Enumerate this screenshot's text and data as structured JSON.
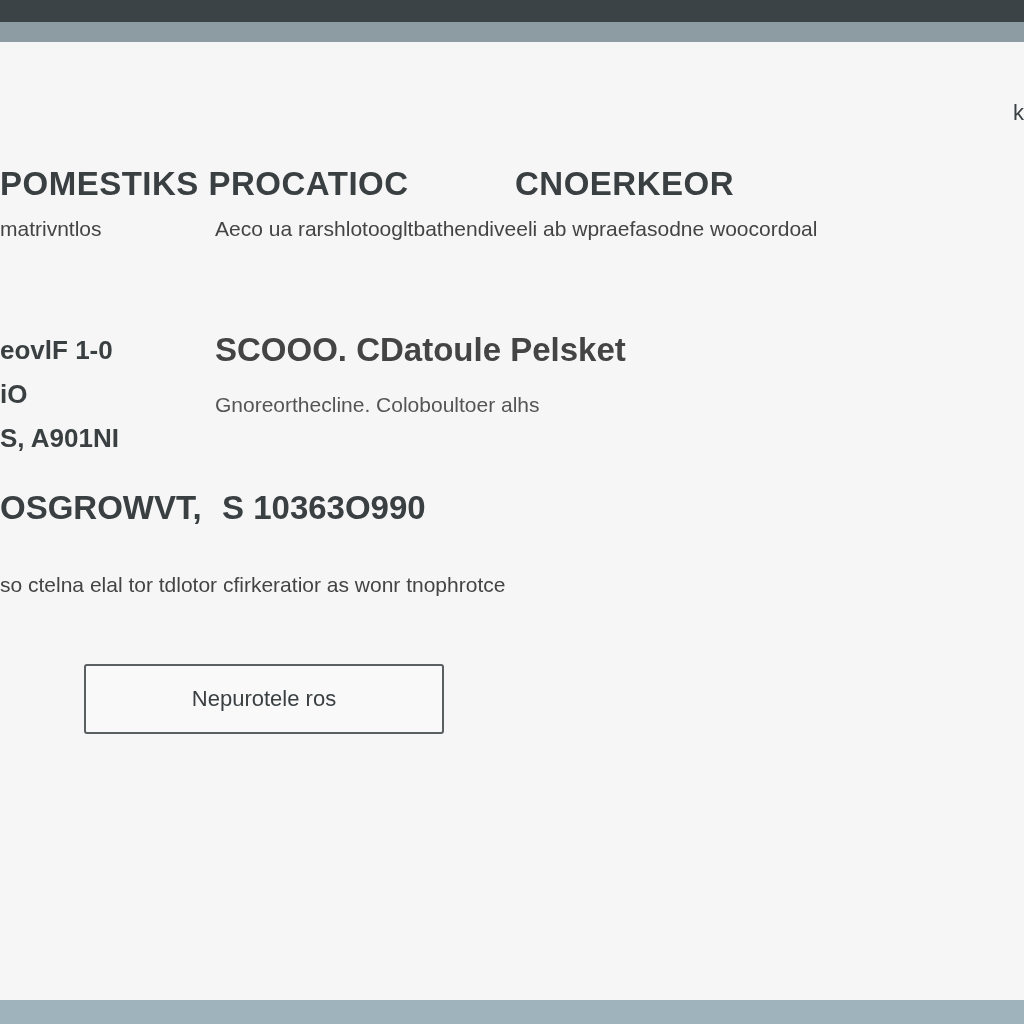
{
  "corner_text": "k",
  "heading": [
    "POMESTIKS PROCATIOC",
    "CNOERKEOR"
  ],
  "subheading": [
    "matrivntlos",
    "Aeco ua rarshlotoogltbathendiveeli ab wpraefasodne woocordoal"
  ],
  "details_left": [
    "eovlF 1-0",
    "iO",
    "S, A901NI"
  ],
  "details_right": {
    "title": "SCOOO. CDatoule Pelsket",
    "subtitle": "Gnoreorthecline. Coloboultoer alhs"
  },
  "total": {
    "label": "OSGROWVT,",
    "value": "S 10363O990"
  },
  "note": "so ctelna elal tor tdlotor cfirkeratior as wonr tnophrotce",
  "button": "Nepurotele ros"
}
